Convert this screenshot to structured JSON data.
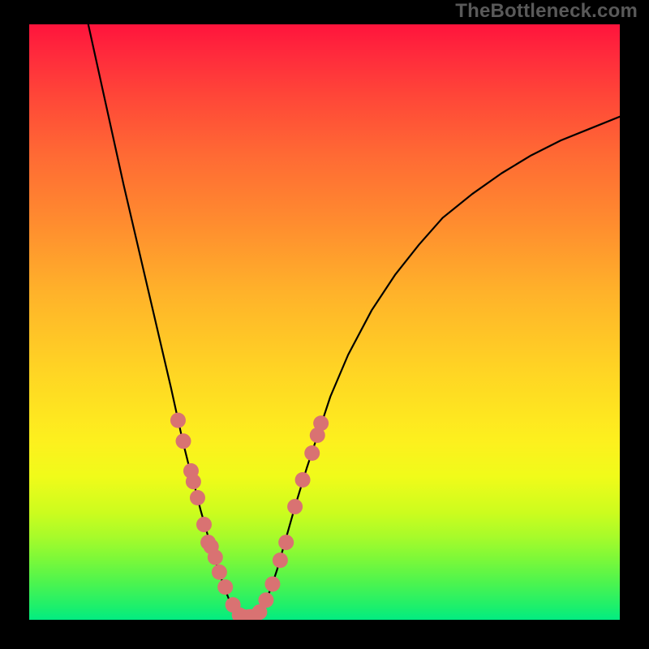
{
  "watermark": "TheBottleneck.com",
  "chart_data": {
    "type": "line",
    "title": "",
    "xlabel": "",
    "ylabel": "",
    "xlim": [
      0,
      100
    ],
    "ylim": [
      0,
      100
    ],
    "legend": false,
    "grid": false,
    "background": "rainbow_vertical_gradient",
    "curve": [
      {
        "x": 10.0,
        "y": 100.0
      },
      {
        "x": 12.0,
        "y": 91.0
      },
      {
        "x": 14.0,
        "y": 82.0
      },
      {
        "x": 16.0,
        "y": 73.0
      },
      {
        "x": 18.0,
        "y": 64.5
      },
      {
        "x": 20.0,
        "y": 56.0
      },
      {
        "x": 22.0,
        "y": 47.5
      },
      {
        "x": 24.0,
        "y": 39.0
      },
      {
        "x": 25.0,
        "y": 34.5
      },
      {
        "x": 26.0,
        "y": 30.0
      },
      {
        "x": 27.0,
        "y": 26.0
      },
      {
        "x": 28.0,
        "y": 22.5
      },
      {
        "x": 29.0,
        "y": 18.5
      },
      {
        "x": 30.0,
        "y": 15.0
      },
      {
        "x": 31.0,
        "y": 11.5
      },
      {
        "x": 32.0,
        "y": 8.5
      },
      {
        "x": 33.0,
        "y": 5.5
      },
      {
        "x": 34.0,
        "y": 3.0
      },
      {
        "x": 35.0,
        "y": 1.2
      },
      {
        "x": 36.0,
        "y": 0.4
      },
      {
        "x": 37.0,
        "y": 0.2
      },
      {
        "x": 38.0,
        "y": 0.4
      },
      {
        "x": 39.0,
        "y": 1.3
      },
      {
        "x": 40.0,
        "y": 3.0
      },
      {
        "x": 41.0,
        "y": 5.5
      },
      {
        "x": 42.0,
        "y": 8.5
      },
      {
        "x": 43.0,
        "y": 12.0
      },
      {
        "x": 44.0,
        "y": 15.5
      },
      {
        "x": 45.0,
        "y": 19.0
      },
      {
        "x": 47.0,
        "y": 25.5
      },
      {
        "x": 49.0,
        "y": 31.5
      },
      {
        "x": 51.0,
        "y": 37.5
      },
      {
        "x": 54.0,
        "y": 44.5
      },
      {
        "x": 58.0,
        "y": 52.0
      },
      {
        "x": 62.0,
        "y": 58.0
      },
      {
        "x": 66.0,
        "y": 63.0
      },
      {
        "x": 70.0,
        "y": 67.5
      },
      {
        "x": 75.0,
        "y": 71.5
      },
      {
        "x": 80.0,
        "y": 75.0
      },
      {
        "x": 85.0,
        "y": 78.0
      },
      {
        "x": 90.0,
        "y": 80.5
      },
      {
        "x": 95.0,
        "y": 82.5
      },
      {
        "x": 100.0,
        "y": 84.5
      }
    ],
    "dots": [
      {
        "x": 25.2,
        "y": 33.5
      },
      {
        "x": 26.1,
        "y": 30.0
      },
      {
        "x": 27.4,
        "y": 25.0
      },
      {
        "x": 27.8,
        "y": 23.2
      },
      {
        "x": 28.5,
        "y": 20.5
      },
      {
        "x": 29.6,
        "y": 16.0
      },
      {
        "x": 30.3,
        "y": 13.0
      },
      {
        "x": 30.8,
        "y": 12.3
      },
      {
        "x": 31.5,
        "y": 10.5
      },
      {
        "x": 32.2,
        "y": 8.0
      },
      {
        "x": 33.2,
        "y": 5.5
      },
      {
        "x": 34.5,
        "y": 2.5
      },
      {
        "x": 35.6,
        "y": 0.8
      },
      {
        "x": 36.3,
        "y": 0.5
      },
      {
        "x": 37.3,
        "y": 0.5
      },
      {
        "x": 38.2,
        "y": 0.6
      },
      {
        "x": 39.0,
        "y": 1.3
      },
      {
        "x": 40.1,
        "y": 3.3
      },
      {
        "x": 41.2,
        "y": 6.0
      },
      {
        "x": 42.5,
        "y": 10.0
      },
      {
        "x": 43.5,
        "y": 13.0
      },
      {
        "x": 45.0,
        "y": 19.0
      },
      {
        "x": 46.3,
        "y": 23.5
      },
      {
        "x": 47.9,
        "y": 28.0
      },
      {
        "x": 48.8,
        "y": 31.0
      },
      {
        "x": 49.4,
        "y": 33.0
      }
    ],
    "dot_color": "#d97272",
    "curve_color": "#000000"
  }
}
